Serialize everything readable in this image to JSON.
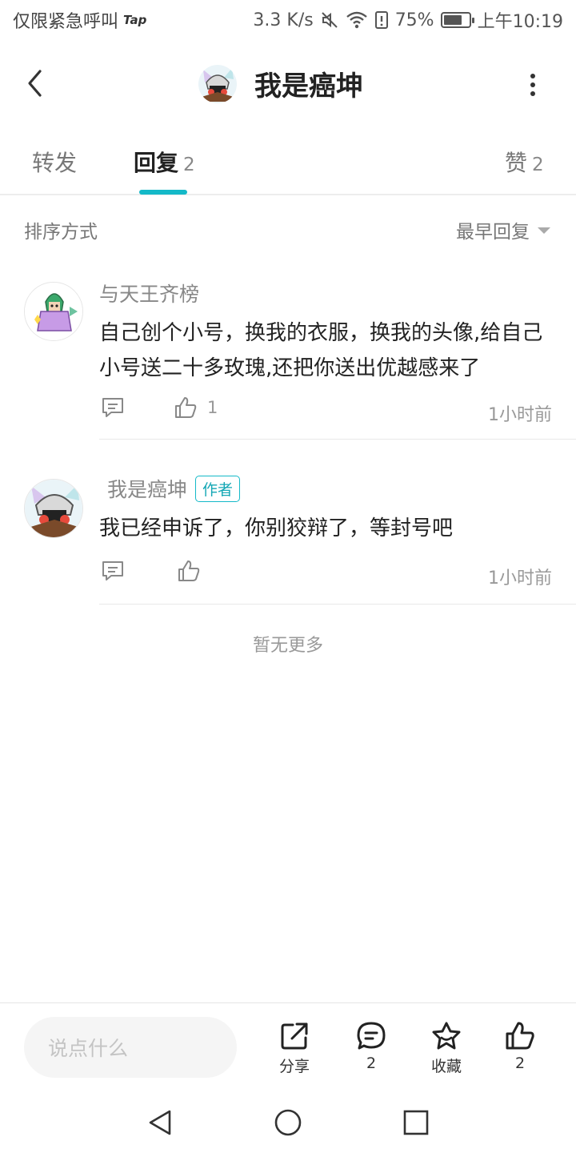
{
  "status_bar": {
    "carrier": "仅限紧急呼叫",
    "tap_label": "Tap",
    "speed": "3.3 K/s",
    "battery": "75%",
    "battery_level": 0.75,
    "time": "上午10:19"
  },
  "header": {
    "title": "我是癌坤"
  },
  "tabs": [
    {
      "label": "转发",
      "count": ""
    },
    {
      "label": "回复",
      "count": "2"
    },
    {
      "label": "赞",
      "count": "2"
    }
  ],
  "sort": {
    "label": "排序方式",
    "value": "最早回复"
  },
  "replies": [
    {
      "author": "与天王齐榜",
      "badge": "",
      "content": "自己创个小号，换我的衣服，换我的头像,给自己小号送二十多玫瑰,还把你送出优越感来了",
      "likes": "1",
      "time": "1小时前"
    },
    {
      "author": "我是癌坤",
      "badge": "作者",
      "content": "我已经申诉了，你别狡辩了，等封号吧",
      "likes": "",
      "time": "1小时前"
    }
  ],
  "no_more": "暂无更多",
  "bottom_bar": {
    "input_placeholder": "说点什么",
    "share_label": "分享",
    "comment_count": "2",
    "favorite_label": "收藏",
    "like_count": "2"
  },
  "colors": {
    "accent": "#14b9c8",
    "text_primary": "#222222",
    "text_secondary": "#888888"
  }
}
